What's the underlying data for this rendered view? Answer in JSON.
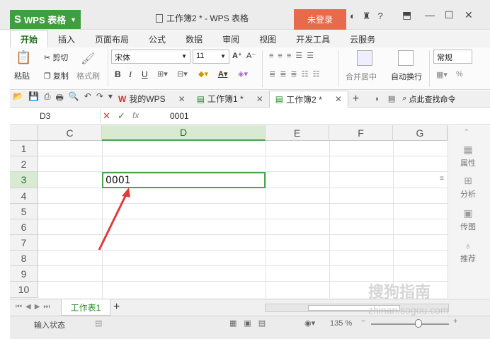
{
  "titlebar": {
    "app_name": "WPS 表格",
    "doc_title": "工作簿2 * - WPS 表格",
    "login": "未登录",
    "help": "?"
  },
  "ribbon_tabs": [
    "开始",
    "插入",
    "页面布局",
    "公式",
    "数据",
    "审阅",
    "视图",
    "开发工具",
    "云服务"
  ],
  "ribbon": {
    "paste": "粘贴",
    "cut": "剪切",
    "copy": "复制",
    "format_painter": "格式刷",
    "font_name": "宋体",
    "font_size": "11",
    "bold": "B",
    "italic": "I",
    "underline": "U",
    "merge_center": "合并居中",
    "wrap_text": "自动换行",
    "number_format": "常规",
    "percent": "%"
  },
  "doc_tabs": {
    "my_wps": "我的WPS",
    "book1": "工作簿1 *",
    "book2": "工作簿2 *",
    "search": "点此查找命令"
  },
  "formula_bar": {
    "name_box": "D3",
    "fx": "fx",
    "value": "0001"
  },
  "grid": {
    "columns": [
      "C",
      "D",
      "E",
      "F",
      "G"
    ],
    "rows": [
      "1",
      "2",
      "3",
      "4",
      "5",
      "6",
      "7",
      "8",
      "9",
      "10"
    ],
    "active_cell_value": "0001"
  },
  "task_pane": [
    "属性",
    "分析",
    "传图",
    "推荐"
  ],
  "sheet_tabs": {
    "sheet1": "工作表1",
    "add": "+"
  },
  "statusbar": {
    "status": "输入状态",
    "zoom": "135 %"
  },
  "watermark": {
    "text": "搜狗指南",
    "url": "zhinan.sogou.com"
  },
  "colors": {
    "accent": "#3f9e3f",
    "login": "#e86a4c",
    "selection": "#4aa54a"
  }
}
